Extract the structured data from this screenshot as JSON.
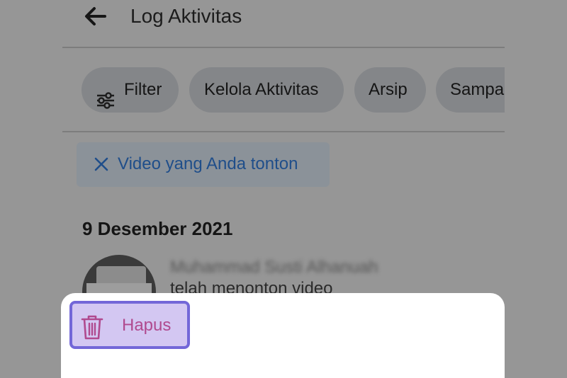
{
  "header": {
    "title": "Log Aktivitas",
    "back_icon": "arrow-left-icon"
  },
  "filters": {
    "chips": [
      {
        "label": "Filter",
        "icon": "sliders-icon"
      },
      {
        "label": "Kelola Aktivitas"
      },
      {
        "label": "Arsip"
      },
      {
        "label": "Sampah"
      }
    ],
    "active_filter": {
      "label": "Video yang Anda tonton",
      "icon": "close-icon"
    }
  },
  "activity": {
    "date": "9 Desember 2021",
    "items": [
      {
        "actor": "Muhammad Susti Alhanuah",
        "description": "telah menonton video"
      }
    ]
  },
  "bottom_sheet": {
    "delete_label": "Hapus",
    "delete_icon": "trash-icon",
    "accent": "#7367d8"
  }
}
